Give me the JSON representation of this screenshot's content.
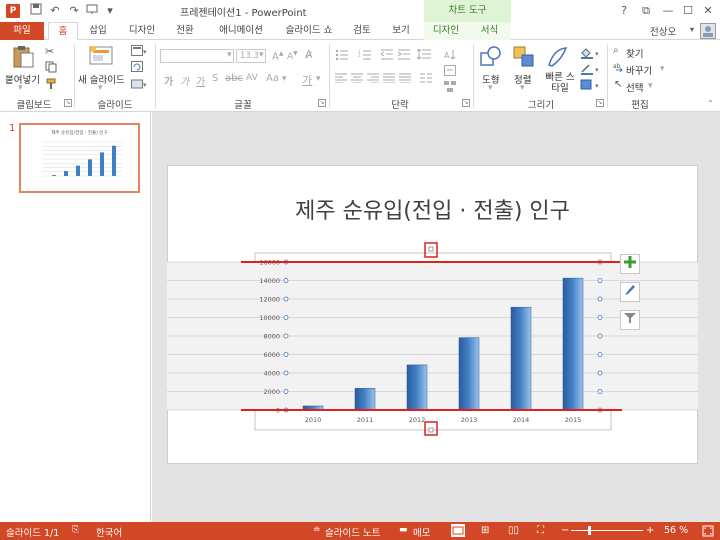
{
  "window": {
    "title": "프레젠테이션1 - PowerPoint",
    "app_badge": "P",
    "chart_tools_label": "차트 도구",
    "controls": [
      "?",
      "⧉",
      "—",
      "☐",
      "✕"
    ]
  },
  "tabs": [
    {
      "label": "파일"
    },
    {
      "label": "홈"
    },
    {
      "label": "삽입"
    },
    {
      "label": "디자인"
    },
    {
      "label": "전환"
    },
    {
      "label": "애니메이션"
    },
    {
      "label": "슬라이드 쇼"
    },
    {
      "label": "검토"
    },
    {
      "label": "보기"
    },
    {
      "label": "디자인"
    },
    {
      "label": "서식"
    }
  ],
  "user": {
    "name": "전상오"
  },
  "ribbon": {
    "groups": [
      {
        "label": "클립보드"
      },
      {
        "label": "슬라이드"
      },
      {
        "label": "글꼴"
      },
      {
        "label": "단락"
      },
      {
        "label": "그리기"
      },
      {
        "label": "편집"
      }
    ],
    "paste_label": "붙여넣기",
    "new_slide_label": "새 슬라이드",
    "font_size_value": "13.3",
    "shapes_label": "도형",
    "arrange_label": "정렬",
    "quick_styles_label": "빠른 스타일",
    "find_label": "찾기",
    "replace_label": "바꾸기",
    "select_label": "선택"
  },
  "thumbnail": {
    "slide_number": "1",
    "title": "제주 순유입(전입 · 전출) 인구"
  },
  "slide": {
    "title": "제주 순유입(전입 · 전출) 인구"
  },
  "chart_data": {
    "type": "bar",
    "title": "",
    "categories": [
      "2010",
      "2011",
      "2012",
      "2013",
      "2014",
      "2015"
    ],
    "values": [
      437,
      2343,
      4876,
      7823,
      11112,
      14257
    ],
    "ylim": [
      0,
      16000
    ],
    "yticks": [
      "0",
      "2000",
      "4000",
      "6000",
      "8000",
      "10000",
      "12000",
      "14000",
      "16000"
    ],
    "grid": true,
    "bar_color": "#3f7fc4"
  },
  "status": {
    "slide_counter": "슬라이드 1/1",
    "language": "한국어",
    "notes_label": "슬라이드 노트",
    "comments_label": "메모",
    "zoom": "56 %"
  }
}
